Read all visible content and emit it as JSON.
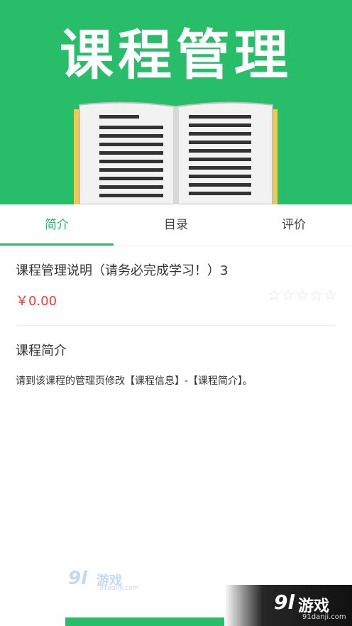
{
  "banner": {
    "title": "课程管理",
    "accent_color": "#27bd69",
    "image": "open-book-icon"
  },
  "tabs": [
    {
      "label": "简介",
      "active": true
    },
    {
      "label": "目录",
      "active": false
    },
    {
      "label": "评价",
      "active": false
    }
  ],
  "course": {
    "title": "课程管理说明（请务必完成学习！）3",
    "price": "￥0.00",
    "price_color": "#e8403b",
    "rating": "☆☆☆☆☆",
    "rating_value": 0,
    "rating_max": 5
  },
  "intro": {
    "heading": "课程简介",
    "body": "请到该课程的管理页修改【课程信息】-【课程简介】。"
  },
  "watermarks": {
    "left_logo": "9l",
    "left_text": "游戏",
    "left_url": "91danji.com",
    "right_logo": "9l",
    "right_text": "游戏",
    "right_url": "91danji.com"
  }
}
